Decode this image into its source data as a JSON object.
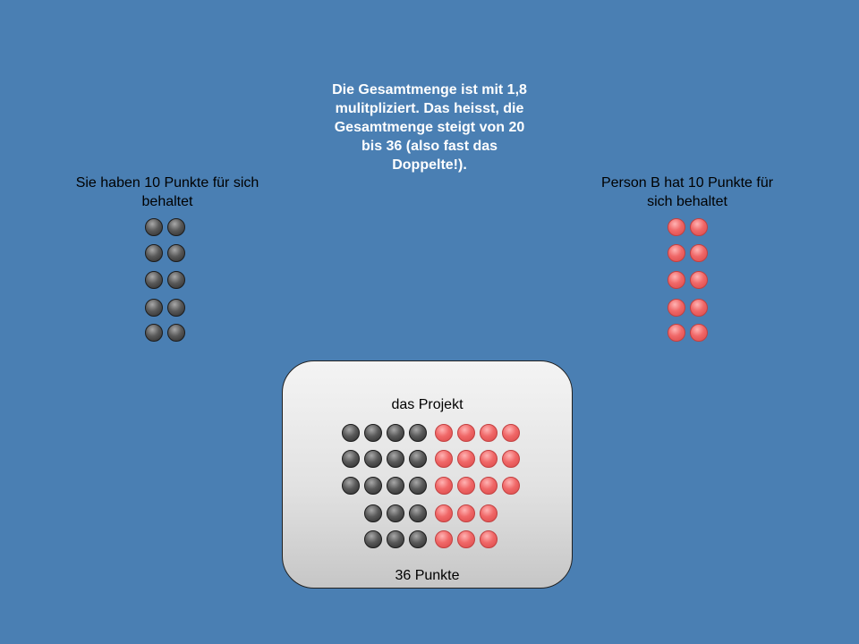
{
  "left_group": {
    "label": "Sie haben 10 Punkte für sich behaltet",
    "points": 10,
    "color": "#3a3a3a"
  },
  "right_group": {
    "label": "Person B hat 10 Punkte für sich behaltet",
    "points": 10,
    "color": "#f05a5a"
  },
  "explanation": "Die Gesamtmenge ist mit 1,8 mulitpliziert. Das heisst, die Gesamtmenge steigt von 20 bis 36 (also fast das Doppelte!).",
  "project": {
    "title": "das Projekt",
    "total_label": "36 Punkte",
    "dark_points": 18,
    "red_points": 18
  },
  "colors": {
    "background": "#4a7fb3",
    "dark_point": "#3a3a3a",
    "red_point": "#f05a5a"
  }
}
